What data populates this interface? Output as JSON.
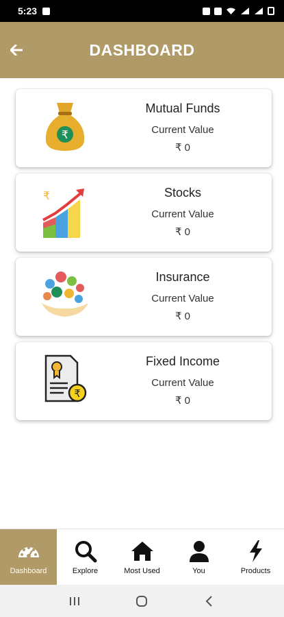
{
  "status_bar": {
    "time": "5:23"
  },
  "header": {
    "title": "DASHBOARD",
    "back_icon": "arrow-left-icon"
  },
  "colors": {
    "accent": "#b09a67",
    "status_bar": "#000000",
    "background": "#ffffff"
  },
  "cards": [
    {
      "title": "Mutual Funds",
      "subtitle": "Current Value",
      "value": "₹ 0",
      "icon": "money-bag-icon"
    },
    {
      "title": "Stocks",
      "subtitle": "Current Value",
      "value": "₹ 0",
      "icon": "growth-chart-icon"
    },
    {
      "title": "Insurance",
      "subtitle": "Current Value",
      "value": "₹ 0",
      "icon": "insurance-hands-icon"
    },
    {
      "title": "Fixed Income",
      "subtitle": "Current Value",
      "value": "₹ 0",
      "icon": "certificate-icon"
    }
  ],
  "bottom_nav": [
    {
      "label": "Dashboard",
      "icon": "speedometer-icon",
      "active": true
    },
    {
      "label": "Explore",
      "icon": "search-icon",
      "active": false
    },
    {
      "label": "Most Used",
      "icon": "home-icon",
      "active": false
    },
    {
      "label": "You",
      "icon": "user-icon",
      "active": false
    },
    {
      "label": "Products",
      "icon": "lightning-icon",
      "active": false
    }
  ]
}
